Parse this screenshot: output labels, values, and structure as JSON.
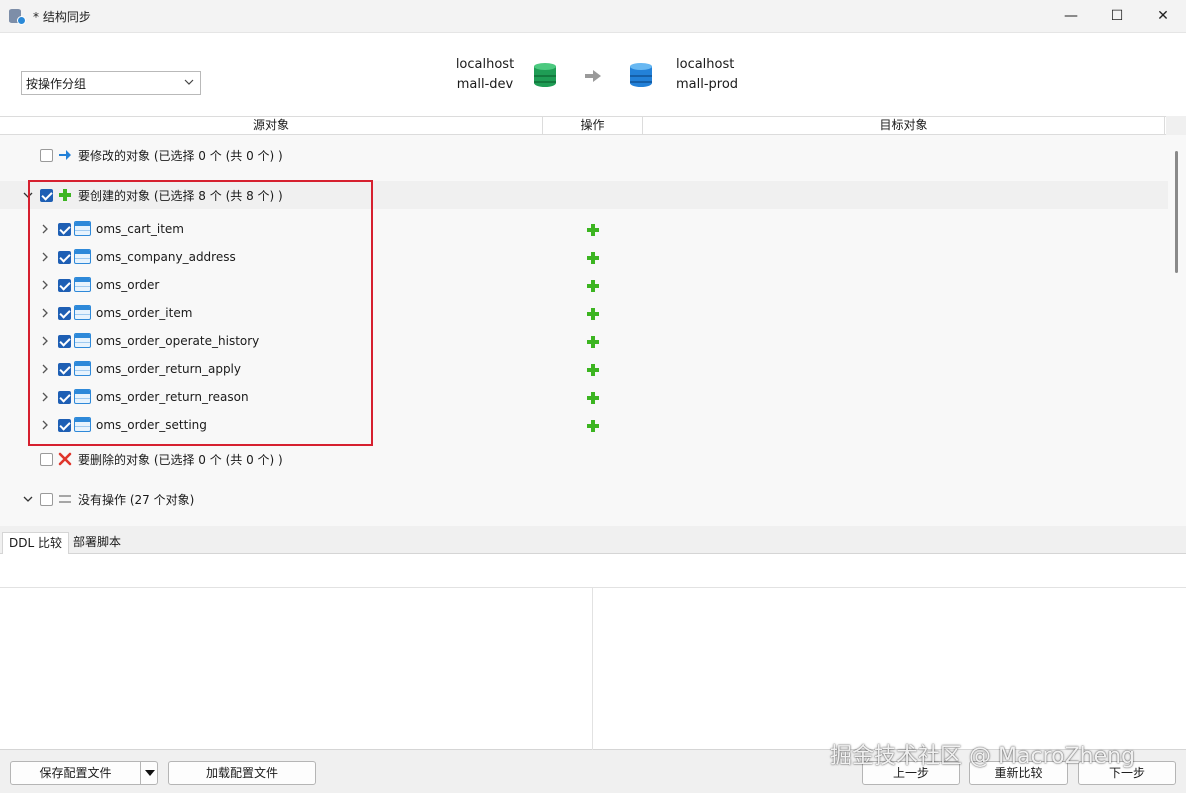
{
  "window": {
    "title": "* 结构同步",
    "controls": {
      "minimize": "—",
      "maximize": "☐",
      "close": "✕"
    }
  },
  "toolbar": {
    "group_by_value": "按操作分组"
  },
  "source": {
    "host": "localhost",
    "database": "mall-dev",
    "icon": "database-green-icon"
  },
  "target": {
    "host": "localhost",
    "database": "mall-prod",
    "icon": "database-blue-icon"
  },
  "columns": {
    "source": "源对象",
    "operation": "操作",
    "target": "目标对象"
  },
  "groups": {
    "modify": {
      "label": "要修改的对象 (已选择 0 个 (共 0 个) )",
      "checked": false,
      "icon": "arrow-right-icon"
    },
    "create": {
      "label": "要创建的对象 (已选择 8 个 (共 8 个) )",
      "checked": true,
      "expanded": true,
      "icon": "plus-icon"
    },
    "delete": {
      "label": "要删除的对象 (已选择 0 个 (共 0 个) )",
      "checked": false,
      "icon": "cross-icon"
    },
    "none": {
      "label": "没有操作 (27 个对象)",
      "checked": false,
      "expanded": true,
      "icon": "equals-icon"
    }
  },
  "create_items": [
    {
      "name": "oms_cart_item",
      "checked": true
    },
    {
      "name": "oms_company_address",
      "checked": true
    },
    {
      "name": "oms_order",
      "checked": true
    },
    {
      "name": "oms_order_item",
      "checked": true
    },
    {
      "name": "oms_order_operate_history",
      "checked": true
    },
    {
      "name": "oms_order_return_apply",
      "checked": true
    },
    {
      "name": "oms_order_return_reason",
      "checked": true
    },
    {
      "name": "oms_order_setting",
      "checked": true
    }
  ],
  "tabs": [
    {
      "label": "DDL 比较",
      "active": true
    },
    {
      "label": "部署脚本",
      "active": false
    }
  ],
  "footer": {
    "save_config": "保存配置文件",
    "load_config": "加载配置文件",
    "prev": "上一步",
    "recompare": "重新比较",
    "next": "下一步"
  },
  "watermark": "掘金技术社区 @ MacroZheng",
  "colors": {
    "accent": "#1e5fb4",
    "create_plus": "#3cb521",
    "delete_cross": "#e0352b",
    "modify_arrow": "#2381d8",
    "highlight": "#d6202f"
  }
}
